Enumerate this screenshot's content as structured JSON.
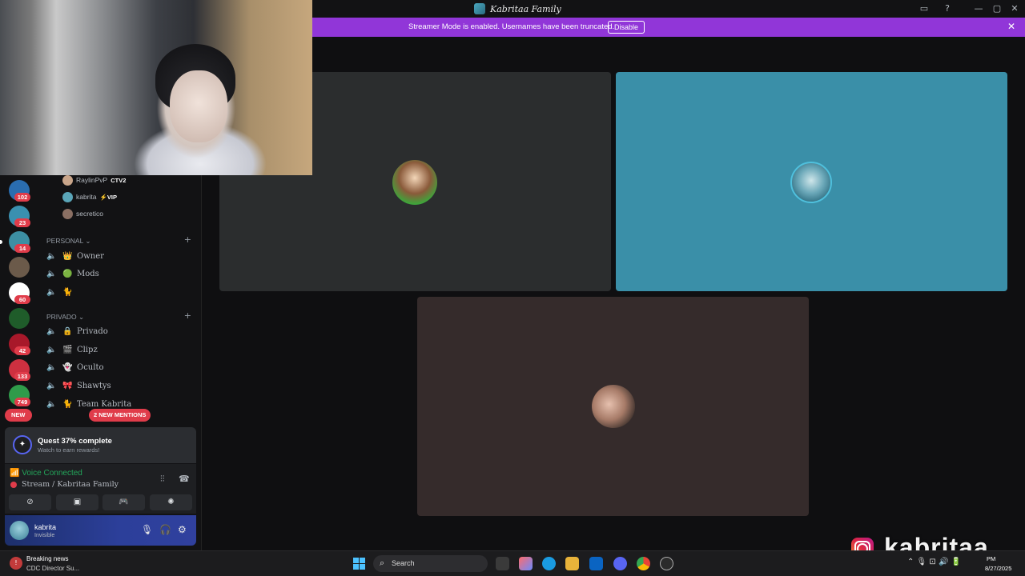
{
  "window": {
    "title": "Kabritaa Family",
    "controls": [
      "minimize-icon",
      "maximize-icon",
      "close-icon"
    ]
  },
  "banner": {
    "text": "Streamer Mode is enabled. Usernames have been truncated.",
    "disable_label": "Disable",
    "color": "#9136d8"
  },
  "server_rail": [
    {
      "badge": "102",
      "color": "#2a6db0"
    },
    {
      "badge": "23",
      "color": "#3a90b0"
    },
    {
      "badge": "14",
      "color": "#3d8fa3"
    },
    {
      "badge": "",
      "color": "#6b5a4a"
    },
    {
      "badge": "60",
      "color": "#ffffff"
    },
    {
      "badge": "",
      "color": "#1f5c2a"
    },
    {
      "badge": "42",
      "color": "#a8182a"
    },
    {
      "badge": "133",
      "color": "#ce3040"
    },
    {
      "badge": "749",
      "color": "#2f9b4a"
    }
  ],
  "voice_users": [
    {
      "name": "RaylinPvP",
      "tag": "CTV2"
    },
    {
      "name": "kabrita",
      "tag": "⚡VIP"
    },
    {
      "name": "secretico",
      "tag": ""
    }
  ],
  "categories": [
    {
      "label": "PERSONAL",
      "channels": [
        {
          "emoji": "👑",
          "name": "Owner"
        },
        {
          "emoji": "🟢",
          "name": "Mods"
        },
        {
          "emoji": "🐈",
          "name": ""
        }
      ]
    },
    {
      "label": "PRIVADO",
      "channels": [
        {
          "emoji": "🔒",
          "name": "Privado"
        },
        {
          "emoji": "🎬",
          "name": "Clipz"
        },
        {
          "emoji": "👻",
          "name": "Oculto"
        },
        {
          "emoji": "🎀",
          "name": "Shawtys"
        },
        {
          "emoji": "🐈",
          "name": "Team Kabrita"
        }
      ]
    }
  ],
  "pills": {
    "new": "NEW",
    "mentions": "2 NEW MENTIONS"
  },
  "quest": {
    "title": "Quest 37% complete",
    "subtitle": "Watch to earn rewards!",
    "progress": 0.37
  },
  "voice": {
    "status": "Voice Connected",
    "channel": "Stream / Kabritaa Family"
  },
  "user": {
    "name": "kabrita",
    "status": "Invisible"
  },
  "tiles": [
    {
      "name": "tile-1",
      "color": "#2b2d2e"
    },
    {
      "name": "tile-2",
      "color": "#3a8fa8"
    },
    {
      "name": "tile-3",
      "color": "#352b2b"
    }
  ],
  "watermark": {
    "handle": "kabritaa"
  },
  "taskbar": {
    "news_title": "Breaking news",
    "news_sub": "CDC Director Su...",
    "search_placeholder": "Search",
    "date": "8/27/2025",
    "time": "PM"
  }
}
